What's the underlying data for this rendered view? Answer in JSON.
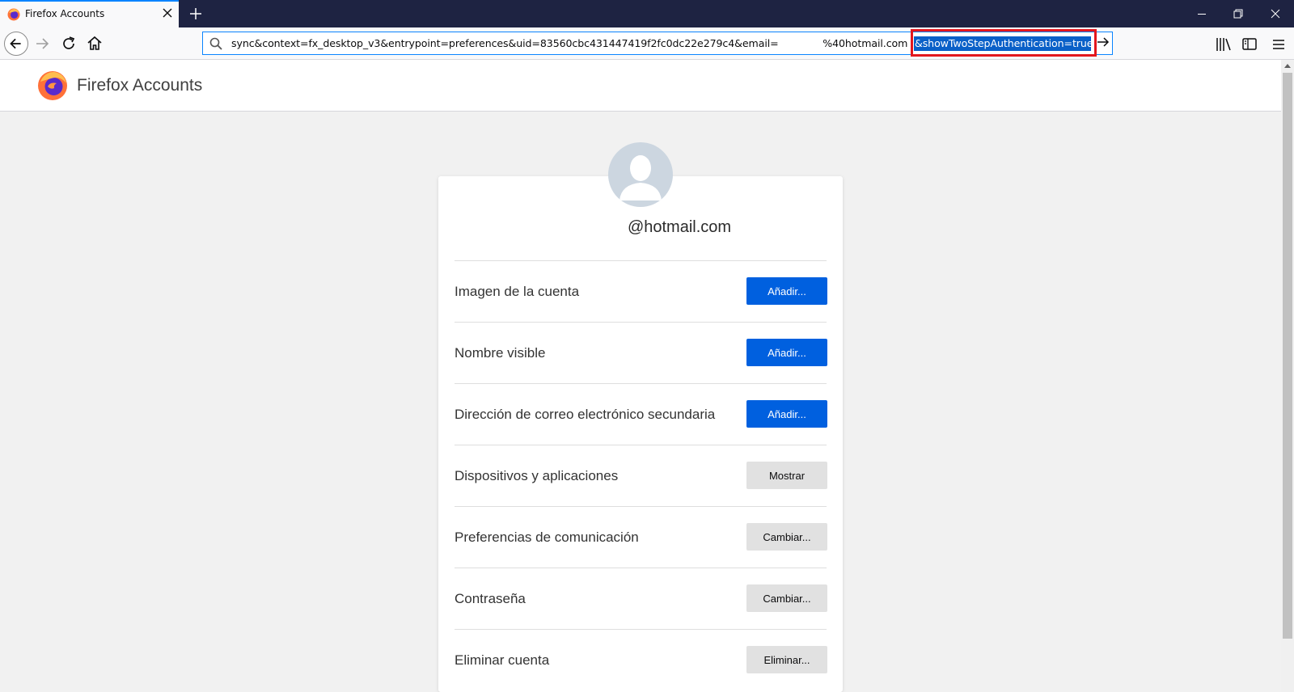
{
  "browser": {
    "tab": {
      "title": "Firefox Accounts"
    },
    "url": {
      "text": "sync&context=fx_desktop_v3&entrypoint=preferences&uid=83560cbc431447419f2fc0dc22e279c4&email=              %40hotmail.com",
      "selected_text": "&showTwoStepAuthentication=true",
      "highlight_color": "#e3161d"
    },
    "colors": {
      "titlebar": "#1e2342",
      "accent": "#0a84ff"
    }
  },
  "page": {
    "brand": {
      "name": "Firefox Accounts"
    },
    "account": {
      "email": "@hotmail.com"
    },
    "settings": [
      {
        "label": "Imagen de la cuenta",
        "button": "Añadir...",
        "style": "primary"
      },
      {
        "label": "Nombre visible",
        "button": "Añadir...",
        "style": "primary"
      },
      {
        "label": "Dirección de correo electrónico secundaria",
        "button": "Añadir...",
        "style": "primary"
      },
      {
        "label": "Dispositivos y aplicaciones",
        "button": "Mostrar",
        "style": "secondary"
      },
      {
        "label": "Preferencias de comunicación",
        "button": "Cambiar...",
        "style": "secondary"
      },
      {
        "label": "Contraseña",
        "button": "Cambiar...",
        "style": "secondary"
      },
      {
        "label": "Eliminar cuenta",
        "button": "Eliminar...",
        "style": "secondary"
      }
    ],
    "colors": {
      "primary_button": "#0060df",
      "secondary_button": "#e1e1e1"
    }
  },
  "icons": {
    "tab_favicon": "firefox-logo-icon",
    "close": "close-icon",
    "new_tab": "plus-icon",
    "back": "arrow-left-icon",
    "forward": "arrow-right-icon",
    "reload": "reload-icon",
    "home": "home-icon",
    "search": "search-icon",
    "go": "arrow-right-icon",
    "library": "library-icon",
    "sidebar": "sidebar-icon",
    "menu": "hamburger-menu-icon",
    "avatar": "user-silhouette-icon"
  }
}
